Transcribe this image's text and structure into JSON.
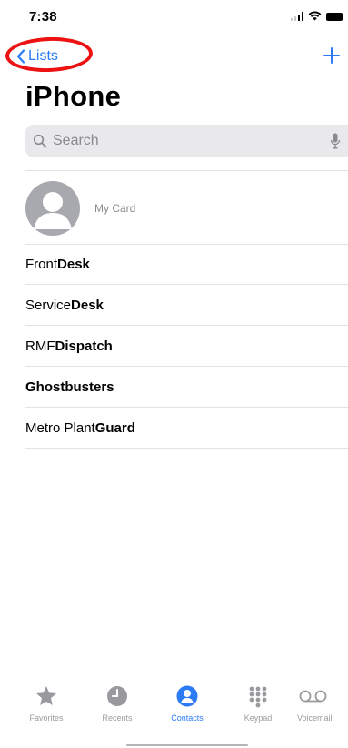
{
  "status_bar": {
    "time": "7:38"
  },
  "nav": {
    "back_label": "Lists",
    "add_icon": "plus-icon"
  },
  "title": "iPhone",
  "search": {
    "placeholder": "Search"
  },
  "my_card": {
    "label": "My Card"
  },
  "contacts": [
    {
      "first": "Front ",
      "last": "Desk"
    },
    {
      "first": "Service ",
      "last": "Desk"
    },
    {
      "first": "RMF ",
      "last": "Dispatch"
    },
    {
      "first": "",
      "last": "Ghostbusters"
    },
    {
      "first": "Metro Plant ",
      "last": "Guard"
    }
  ],
  "tabs": [
    {
      "label": "Favorites",
      "icon": "star-icon",
      "active": false
    },
    {
      "label": "Recents",
      "icon": "clock-icon",
      "active": false
    },
    {
      "label": "Contacts",
      "icon": "person-icon",
      "active": true
    },
    {
      "label": "Keypad",
      "icon": "keypad-icon",
      "active": false
    },
    {
      "label": "Voicemail",
      "icon": "voicemail-icon",
      "active": false
    }
  ],
  "colors": {
    "accent": "#2a7bf5",
    "annotation": "#e11111",
    "avatar": "#a8a9ae"
  }
}
